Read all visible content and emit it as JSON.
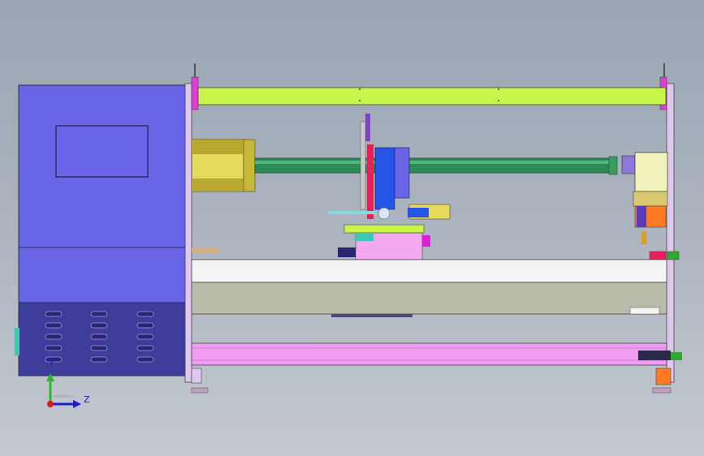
{
  "viewport": {
    "background_top": "#9aa6b4",
    "background_bottom": "#c4c9cf"
  },
  "model": {
    "colors": {
      "control_cabinet": "#6a64e6",
      "cabinet_lower": "#3f3d9c",
      "top_beam": "#c8f54a",
      "bottom_beam": "#f19cf3",
      "frame_post": "#dfc8ee",
      "motor": "#e6da5a",
      "shaft": "#2e8a55",
      "bed": "#f4f4f4",
      "bed_lower": "#babbaa",
      "slide_block": "#f3a8f0",
      "orange_part": "#ff7a22",
      "blue_column": "#2555e6"
    }
  },
  "triad": {
    "y_label": "Y",
    "z_label": "Z",
    "y_color": "#22c022",
    "z_color": "#1c1cd0",
    "x_color": "#e01818"
  }
}
